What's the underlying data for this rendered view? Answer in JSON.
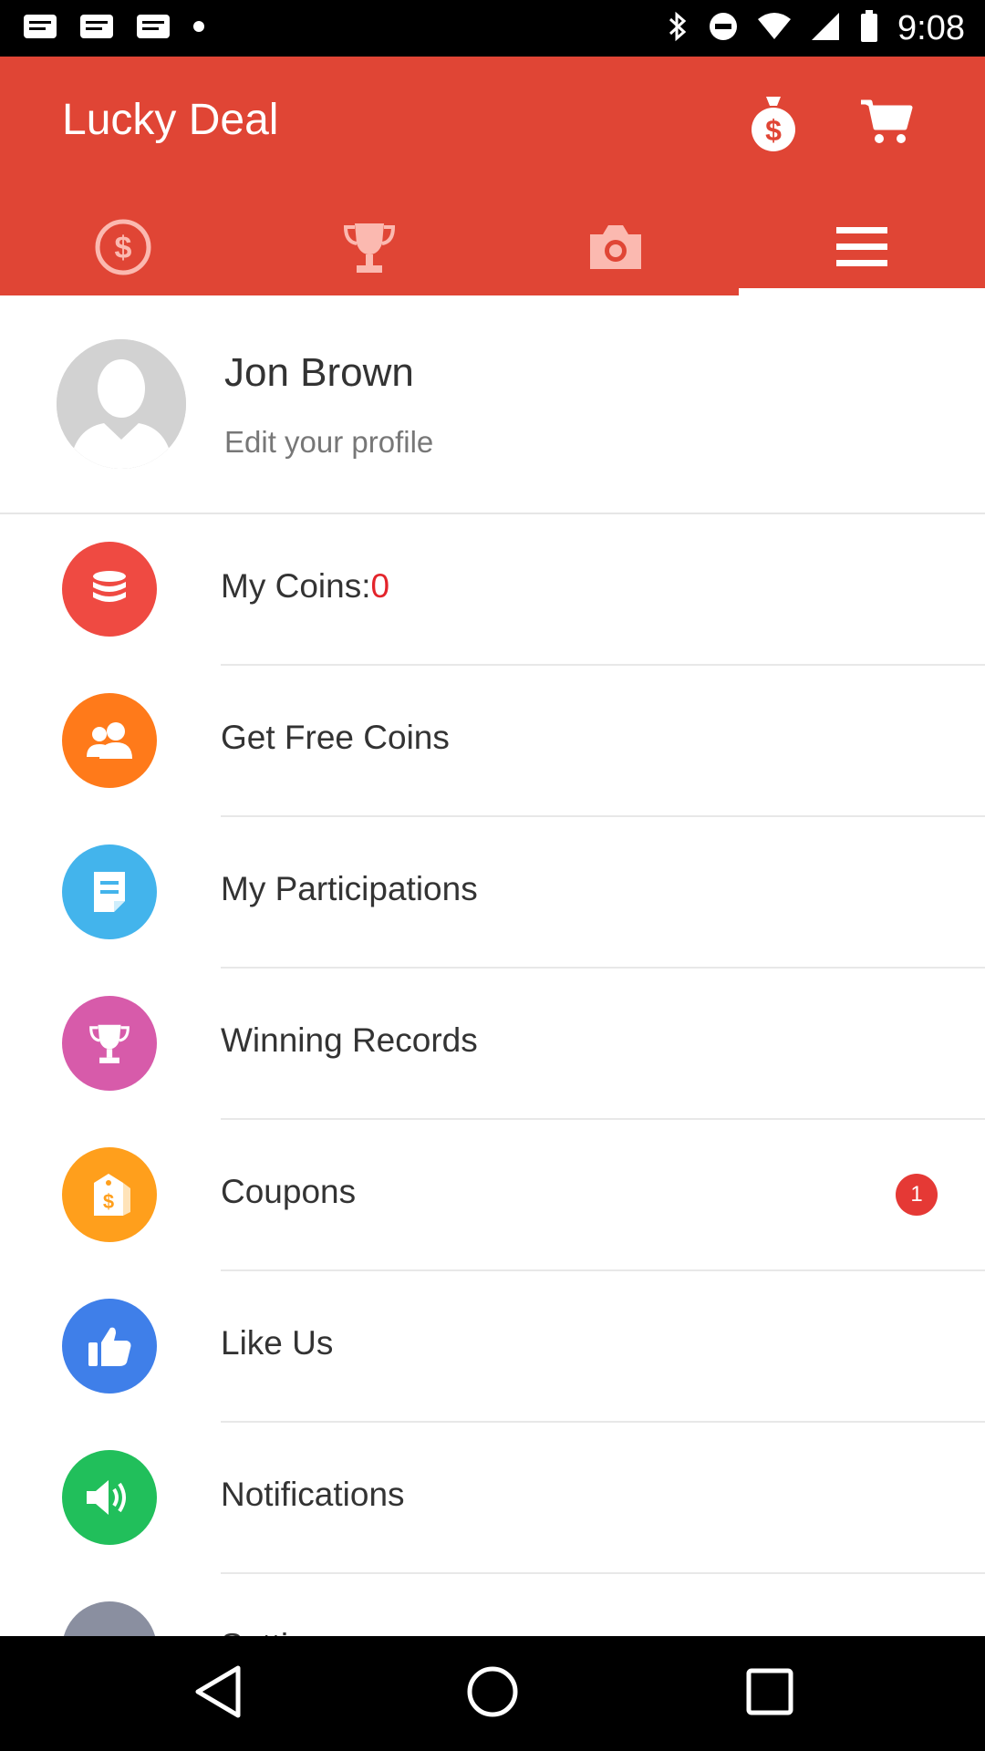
{
  "status_bar": {
    "time": "9:08"
  },
  "app_bar": {
    "title": "Lucky Deal",
    "actions": [
      {
        "icon": "money-bag-icon"
      },
      {
        "icon": "shopping-cart-icon"
      }
    ],
    "tabs": [
      {
        "icon": "dollar-coin-icon"
      },
      {
        "icon": "trophy-icon"
      },
      {
        "icon": "camera-icon"
      },
      {
        "icon": "menu-icon",
        "selected": true
      }
    ]
  },
  "profile": {
    "name": "Jon Brown",
    "subtitle": "Edit your profile"
  },
  "menu": {
    "items": [
      {
        "label": "My Coins:",
        "value": "0",
        "icon": "coins-stack-icon",
        "color": "#EF4A42"
      },
      {
        "label": "Get Free Coins",
        "icon": "users-icon",
        "color": "#FF7A1A"
      },
      {
        "label": "My Participations",
        "icon": "document-icon",
        "color": "#43B4EC"
      },
      {
        "label": "Winning Records",
        "icon": "trophy-icon",
        "color": "#D75BAA"
      },
      {
        "label": "Coupons",
        "icon": "price-tag-icon",
        "color": "#FF9F1C",
        "badge": "1"
      },
      {
        "label": "Like Us",
        "icon": "thumbs-up-icon",
        "color": "#3F7FE9"
      },
      {
        "label": "Notifications",
        "icon": "speaker-icon",
        "color": "#21BF5B"
      },
      {
        "label": "Settings",
        "icon": "settings-icon",
        "color": "#8A8FA0"
      }
    ]
  },
  "colors": {
    "accent": "#E04535",
    "badge": "#E53935",
    "coins_value": "#E3242B"
  }
}
